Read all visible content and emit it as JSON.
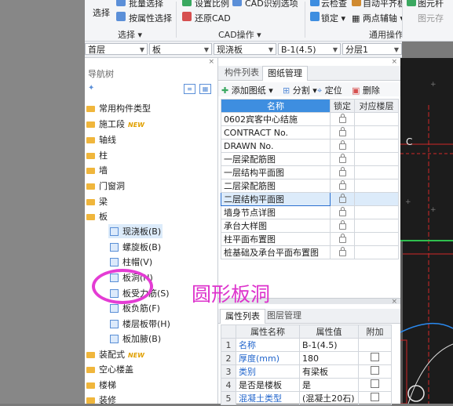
{
  "ribbon": {
    "select_big": "选择",
    "batch_select": "批量选择",
    "attr_select": "按属性选择",
    "group_select": "选择",
    "set_ratio": "设置比例",
    "restore_cad": "还原CAD",
    "cad_options": "CAD识别选项",
    "group_cad": "CAD操作",
    "cloud_check": "云检查",
    "auto_flat": "自动平齐板",
    "lock": "锁定",
    "two_point_axis": "两点辅轴",
    "group_general": "通用操作",
    "right_partial1": "图元杆",
    "right_partial2": "图元存"
  },
  "selector": {
    "floor": "首层",
    "type": "板",
    "subtype": "现浇板",
    "name": "B-1(4.5)",
    "layer": "分层1"
  },
  "nav": {
    "title": "导航树",
    "items": [
      {
        "label": "常用构件类型",
        "new": ""
      },
      {
        "label": "施工段",
        "new": "NEW"
      },
      {
        "label": "轴线",
        "new": ""
      },
      {
        "label": "柱",
        "new": ""
      },
      {
        "label": "墙",
        "new": ""
      },
      {
        "label": "门窗洞",
        "new": ""
      },
      {
        "label": "梁",
        "new": ""
      },
      {
        "label": "板",
        "new": ""
      }
    ],
    "sub_items": [
      {
        "label": "现浇板(B)"
      },
      {
        "label": "螺旋板(B)"
      },
      {
        "label": "柱帽(V)"
      },
      {
        "label": "板洞(N)"
      },
      {
        "label": "板受力筋(S)"
      },
      {
        "label": "板负筋(F)"
      },
      {
        "label": "楼层板带(H)"
      },
      {
        "label": "板加腋(B)"
      }
    ],
    "bottom_items": [
      {
        "label": "装配式",
        "new": "NEW"
      },
      {
        "label": "空心楼盖",
        "new": ""
      },
      {
        "label": "楼梯",
        "new": ""
      },
      {
        "label": "装修",
        "new": ""
      }
    ]
  },
  "drawings": {
    "tabs": [
      "构件列表",
      "图纸管理"
    ],
    "toolbar": {
      "add": "添加图纸",
      "split": "分割",
      "locate": "定位",
      "delete": "删除"
    },
    "headers": [
      "名称",
      "锁定",
      "对应楼层"
    ],
    "rows": [
      "0602宾客中心结施",
      "CONTRACT No.",
      "DRAWN No.",
      "一层梁配筋图",
      "一层结构平面图",
      "二层梁配筋图",
      "二层结构平面图",
      "墙身节点详图",
      "承台大样图",
      "柱平面布置图",
      "桩基础及承台平面布置图"
    ]
  },
  "props": {
    "tabs": [
      "属性列表",
      "图层管理"
    ],
    "headers": [
      "属性名称",
      "属性值",
      "附加"
    ],
    "rows": [
      {
        "idx": "1",
        "name": "名称",
        "value": "B-1(4.5)",
        "blue": true,
        "cb": false
      },
      {
        "idx": "2",
        "name": "厚度(mm)",
        "value": "180",
        "blue": true,
        "cb": true
      },
      {
        "idx": "3",
        "name": "类别",
        "value": "有梁板",
        "blue": true,
        "cb": true
      },
      {
        "idx": "4",
        "name": "是否是楼板",
        "value": "是",
        "blue": false,
        "cb": true
      },
      {
        "idx": "5",
        "name": "混凝土类型",
        "value": "(混凝土20石)",
        "blue": true,
        "cb": true
      }
    ]
  },
  "cad": {
    "label": "C"
  },
  "annotation": "圆形板洞",
  "colors": {
    "accent": "#3e8ee0",
    "annotation": "#dd33cc"
  }
}
